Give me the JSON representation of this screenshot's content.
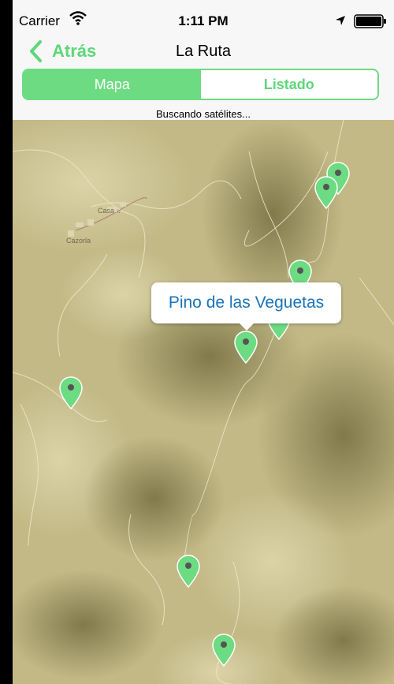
{
  "status_bar": {
    "carrier": "Carrier",
    "time": "1:11 PM"
  },
  "nav": {
    "back_label": "Atrás",
    "title": "La Ruta"
  },
  "segments": {
    "map_label": "Mapa",
    "list_label": "Listado",
    "selected": "Mapa"
  },
  "status_message": "Buscando satélites...",
  "map": {
    "callout_text": "Pino de las Veguetas",
    "place_labels": [
      "Cazorla",
      "Casa..."
    ],
    "pins": [
      "pin",
      "pin",
      "pin",
      "pin",
      "pin",
      "pin",
      "pin",
      "pin"
    ]
  },
  "colors": {
    "accent": "#5fd67a",
    "callout_text": "#1a74b8",
    "map_base": "#c6bd8c"
  },
  "icons": [
    "wifi-icon",
    "location-arrow-icon",
    "battery-icon",
    "back-chevron-icon",
    "map-pin-icon"
  ]
}
